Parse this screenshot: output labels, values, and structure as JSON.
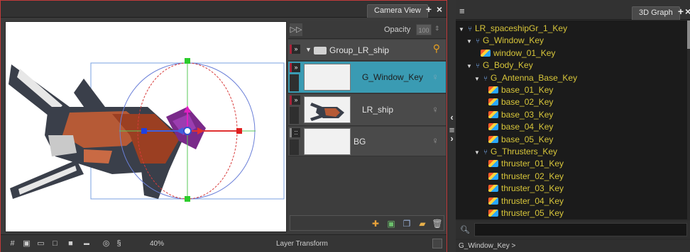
{
  "camera_view": {
    "tab_label": "Camera View",
    "add_icon": "plus-icon",
    "close_icon": "close-icon"
  },
  "layers_panel": {
    "opacity_label": "Opacity",
    "opacity_value": "100",
    "layers": [
      {
        "name": "Group_LR_ship",
        "type": "group"
      },
      {
        "name": "G_Window_Key",
        "type": "layer",
        "selected": true
      },
      {
        "name": "LR_ship",
        "type": "layer"
      },
      {
        "name": "BG",
        "type": "layer"
      }
    ],
    "bottom_icons": [
      "add-peg-icon",
      "add-drawing-icon",
      "duplicate-icon",
      "group-icon",
      "delete-icon"
    ]
  },
  "status_bar": {
    "zoom": "40%",
    "mode": "Layer Transform"
  },
  "graph_3d": {
    "tab_label": "3D Graph",
    "tree": [
      {
        "label": "LR_spaceshipGr_1_Key",
        "depth": 0,
        "kind": "group"
      },
      {
        "label": "G_Window_Key",
        "depth": 1,
        "kind": "group"
      },
      {
        "label": "window_01_Key",
        "depth": 2,
        "kind": "peg"
      },
      {
        "label": "G_Body_Key",
        "depth": 1,
        "kind": "group"
      },
      {
        "label": "G_Antenna_Base_Key",
        "depth": 2,
        "kind": "group"
      },
      {
        "label": "base_01_Key",
        "depth": 3,
        "kind": "peg"
      },
      {
        "label": "base_02_Key",
        "depth": 3,
        "kind": "peg"
      },
      {
        "label": "base_03_Key",
        "depth": 3,
        "kind": "peg"
      },
      {
        "label": "base_04_Key",
        "depth": 3,
        "kind": "peg"
      },
      {
        "label": "base_05_Key",
        "depth": 3,
        "kind": "peg"
      },
      {
        "label": "G_Thrusters_Key",
        "depth": 2,
        "kind": "group"
      },
      {
        "label": "thruster_01_Key",
        "depth": 3,
        "kind": "peg"
      },
      {
        "label": "thruster_02_Key",
        "depth": 3,
        "kind": "peg"
      },
      {
        "label": "thruster_03_Key",
        "depth": 3,
        "kind": "peg"
      },
      {
        "label": "thruster_04_Key",
        "depth": 3,
        "kind": "peg"
      },
      {
        "label": "thruster_05_Key",
        "depth": 3,
        "kind": "peg"
      }
    ],
    "search_placeholder": "",
    "breadcrumb": "G_Window_Key >"
  },
  "colors": {
    "frame_border": "#c23a3a",
    "selected_layer": "#3a9bb3",
    "tree_text": "#d8c63a"
  }
}
